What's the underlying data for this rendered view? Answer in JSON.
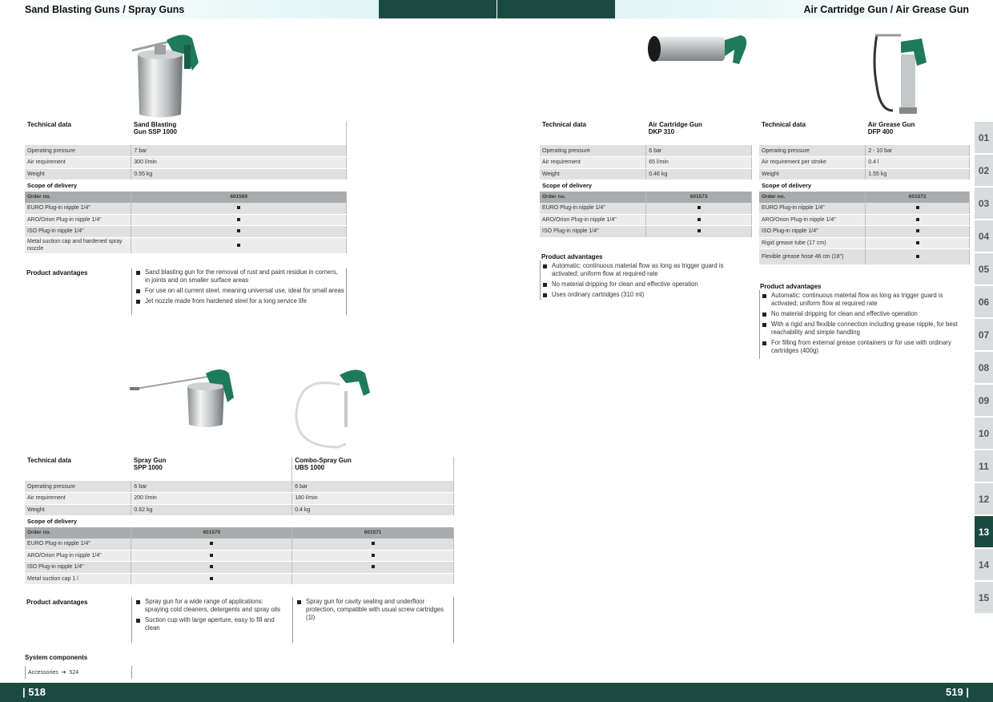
{
  "header": {
    "left_title": "Sand Blasting Guns / Spray Guns",
    "right_title": "Air Cartridge Gun / Air Grease Gun"
  },
  "footer": {
    "left_page": "| 518",
    "right_page": "519 |"
  },
  "tabs": [
    "01",
    "02",
    "03",
    "04",
    "05",
    "06",
    "07",
    "08",
    "09",
    "10",
    "11",
    "12",
    "13",
    "14",
    "15"
  ],
  "active_tab": "13",
  "ssp": {
    "tech_label": "Technical data",
    "product_line1": "Sand Blasting",
    "product_line2": "Gun SSP 1000",
    "rows": [
      {
        "label": "Operating pressure",
        "value": "7 bar"
      },
      {
        "label": "Air requirement",
        "value": "300 l/min"
      },
      {
        "label": "Weight",
        "value": "0.55 kg"
      }
    ],
    "scope_label": "Scope of delivery",
    "order_label": "Order no.",
    "order_no": "601569",
    "scope": [
      "EURO Plug-in nipple 1/4\"",
      "ARO/Orion Plug-in nipple 1/4\"",
      "ISO Plug-in nipple 1/4\"",
      "Metal suction cap and hardened spray nozzle"
    ],
    "pa_label": "Product advantages",
    "advantages": [
      "Sand blasting gun for the removal of rust and paint residue in corners, in joints and on smaller surface areas",
      "For use on all current steel, meaning universal use, ideal for small areas",
      "Jet nozzle made from hardened steel for a long service life"
    ]
  },
  "spp": {
    "tech_label": "Technical data",
    "p1_line1": "Spray Gun",
    "p1_line2": "SPP 1000",
    "p2_line1": "Combo-Spray Gun",
    "p2_line2": "UBS 1000",
    "rows": [
      {
        "label": "Operating pressure",
        "v1": "6 bar",
        "v2": "6 bar"
      },
      {
        "label": "Air requirement",
        "v1": "200 l/min",
        "v2": "180 l/min"
      },
      {
        "label": "Weight",
        "v1": "0.62 kg",
        "v2": "0.4 kg"
      }
    ],
    "scope_label": "Scope of delivery",
    "order_label": "Order no.",
    "order1": "601570",
    "order2": "601571",
    "scope": [
      "EURO Plug-in nipple 1/4\"",
      "ARO/Orion Plug-in nipple 1/4\"",
      "ISO Plug-in nipple 1/4\"",
      "Metal suction cap 1 l"
    ],
    "pa_label": "Product advantages",
    "adv1": [
      "Spray gun for a wide range of applications: spraying cold cleaners, detergents and spray oils",
      "Suction cup with large aperture, easy to fill and clean"
    ],
    "adv2": [
      "Spray gun for cavity sealing and underfloor protection, compatible with usual screw cartridges (1l)"
    ]
  },
  "system": {
    "title": "System components",
    "accessories": "Accessories",
    "arrow": "➔",
    "page": "524"
  },
  "dkp": {
    "tech_label": "Technical data",
    "product_line1": "Air Cartridge Gun",
    "product_line2": "DKP 310",
    "rows": [
      {
        "label": "Operating pressure",
        "value": "6 bar"
      },
      {
        "label": "Air requirement",
        "value": "65 l/min"
      },
      {
        "label": "Weight",
        "value": "0.46 kg"
      }
    ],
    "scope_label": "Scope of delivery",
    "order_label": "Order no.",
    "order_no": "601573",
    "scope": [
      "EURO Plug-in nipple 1/4\"",
      "ARO/Orion Plug-in nipple 1/4\"",
      "ISO Plug-in nipple 1/4\""
    ],
    "pa_label": "Product advantages",
    "advantages": [
      "Automatic: continuous material flow as long as trigger guard is activated; uniform flow at required rate",
      "No material dripping for clean and effective operation",
      "Uses ordinary cartridges (310 ml)"
    ]
  },
  "dfp": {
    "tech_label": "Technical data",
    "product_line1": "Air Grease Gun",
    "product_line2": "DFP 400",
    "rows": [
      {
        "label": "Operating pressure",
        "value": "2 - 10 bar"
      },
      {
        "label": "Air requirement per stroke",
        "value": "0.4 l"
      },
      {
        "label": "Weight",
        "value": "1.55 kg"
      }
    ],
    "scope_label": "Scope of delivery",
    "order_label": "Order no.",
    "order_no": "601572",
    "scope": [
      "EURO Plug-in nipple 1/4\"",
      "ARO/Orion Plug-in nipple 1/4\"",
      "ISO Plug-in nipple 1/4\"",
      "Rigid grease tube (17 cm)",
      "Flexible grease hose 46 cm (18\")"
    ],
    "pa_label": "Product advantages",
    "advantages": [
      "Automatic: continuous material flow as long as trigger guard is activated; uniform flow at required rate",
      "No material dripping for clean and effective operation",
      "With a rigid and flexible connection including grease nipple, for best reachability and simple handling",
      "For filling from external grease containers or for use with ordinary cartridges (400g)"
    ]
  },
  "colors": {
    "brand_dark": "#1b4a40",
    "tab_gray": "#d9dcdd",
    "row_gray": "#e0e0e0",
    "order_gray": "#a9acad",
    "gun_green": "#1e7a5c"
  },
  "icons": [
    "square-bullet-icon",
    "arrow-right-icon"
  ]
}
